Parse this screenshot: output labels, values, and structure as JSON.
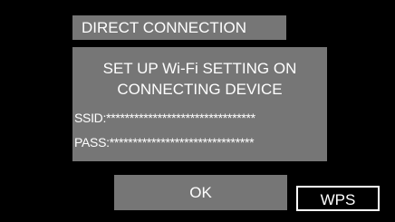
{
  "dialog": {
    "title": "DIRECT CONNECTION",
    "message_line1": "SET UP Wi-Fi SETTING ON",
    "message_line2": "CONNECTING DEVICE",
    "ssid_text": "SSID:********************************",
    "pass_text": "PASS:*******************************"
  },
  "buttons": {
    "ok_label": "OK",
    "wps_label": "WPS"
  },
  "colors": {
    "background": "#000000",
    "panel": "#767676",
    "text": "#ffffff"
  }
}
